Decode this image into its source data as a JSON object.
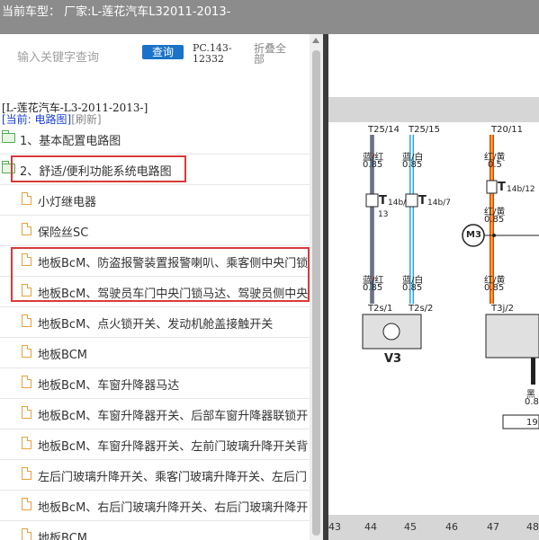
{
  "header": {
    "title": "当前车型： 厂家:L-莲花汽车L32011-2013-"
  },
  "search": {
    "placeholder": "输入关键字查询",
    "button": "查询",
    "pc_line1": "PC.143-",
    "pc_line2": "12332",
    "collapse_line1": "折叠全",
    "collapse_line2": "部"
  },
  "tree": {
    "car_path": "[L-莲花汽车-L3-2011-2013-]",
    "current_label": "[当前: 电路图]",
    "refresh_label": "[刷新]",
    "items": [
      {
        "type": "folder",
        "label": "1、基本配置电路图"
      },
      {
        "type": "folder",
        "label": "2、舒适/便利功能系统电路图"
      },
      {
        "type": "file",
        "label": "小灯继电器"
      },
      {
        "type": "file",
        "label": "保险丝SC"
      },
      {
        "type": "file",
        "label": "地板BcM、防盗报警装置报警喇叭、乘客侧中央门锁"
      },
      {
        "type": "file",
        "label": "地板BcM、驾驶员车门中央门锁马达、驾驶员侧中央"
      },
      {
        "type": "file",
        "label": "地板BcM、点火锁开关、发动机舱盖接触开关"
      },
      {
        "type": "file",
        "label": "地板BCM"
      },
      {
        "type": "file",
        "label": "地板BcM、车窗升降器马达"
      },
      {
        "type": "file",
        "label": "地板BcM、车窗升降器开关、后部车窗升降器联锁开"
      },
      {
        "type": "file",
        "label": "地板BcM、车窗升降器开关、左前门玻璃升降开关背"
      },
      {
        "type": "file",
        "label": "左后门玻璃升降开关、乘客门玻璃升降开关、左后门"
      },
      {
        "type": "file",
        "label": "地板BcM、右后门玻璃升降开关、右后门玻璃升降开"
      },
      {
        "type": "file",
        "label": "地板BCM"
      }
    ]
  },
  "diagram": {
    "t25_14": "T25/14",
    "t25_15": "T25/15",
    "t20_11": "T20/11",
    "w1_color": "蓝/红",
    "w1_size": "0.85",
    "w2_color": "蓝/白",
    "w2_size": "0.85",
    "w3_color": "红/黄",
    "w3_size": "0.5",
    "c1_label": "T",
    "c1_sub": "14b/",
    "c1_num": "13",
    "c2_label": "T",
    "c2_sub": "14b/7",
    "c3_label": "T",
    "c3_sub": "14b/12",
    "w3b_color": "红/黄",
    "w3b_size": "0.85",
    "motor_label": "M3",
    "w4_color": "蓝/红",
    "w4_size": "0.85",
    "w5_color": "蓝/白",
    "w5_size": "0.85",
    "w6_color": "红/黄",
    "w6_size": "0.85",
    "t2s_1": "T2s/1",
    "t2s_2": "T2s/2",
    "t3j_2": "T3j/2",
    "v3_label": "V3",
    "black_label": "黑",
    "black_size": "0.8",
    "box_label": "19",
    "colors": {
      "blue": "#2aa7dc",
      "red": "#e03b1e",
      "yellow": "#f3c21b"
    },
    "ruler": [
      "43",
      "44",
      "45",
      "46",
      "47",
      "48"
    ]
  }
}
